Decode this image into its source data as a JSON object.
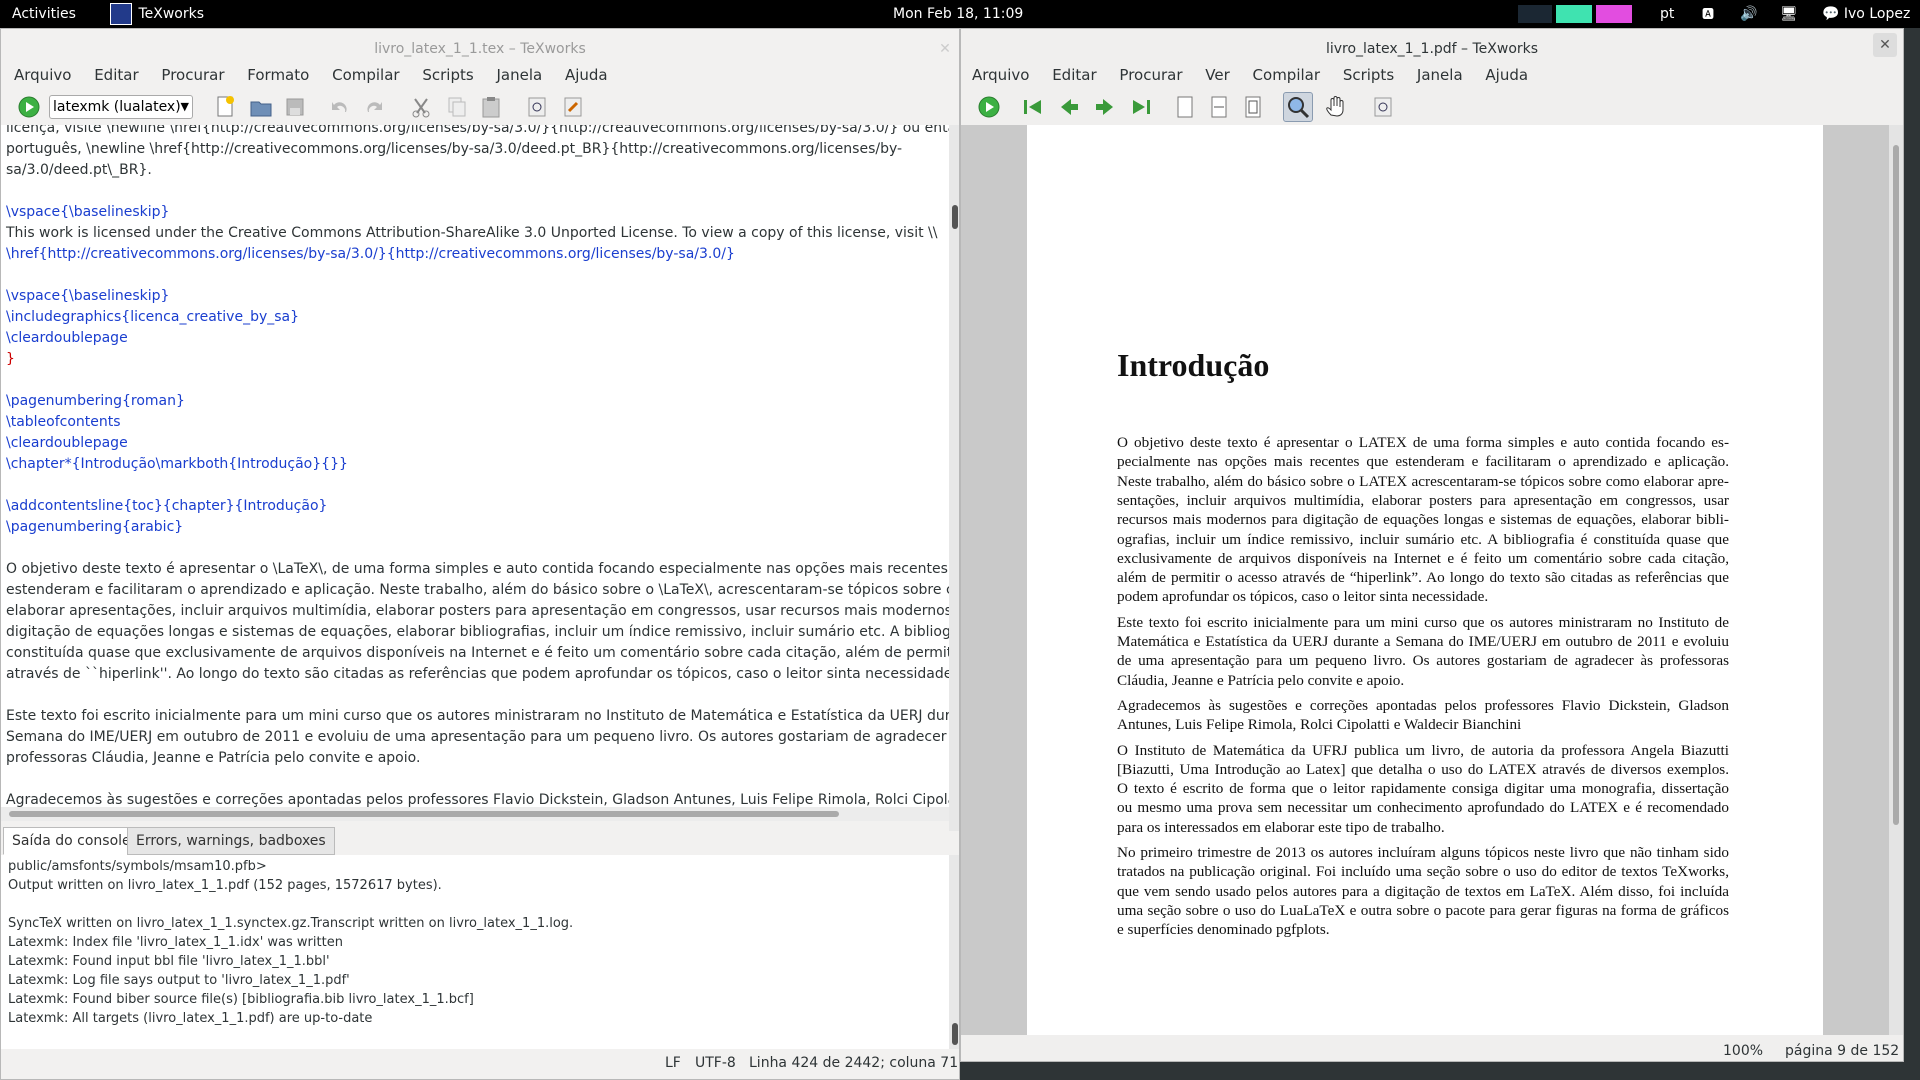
{
  "topbar": {
    "activities": "Activities",
    "app_name": "TeXworks",
    "clock": "Mon Feb 18, 11:09",
    "keyboard": "pt",
    "user": "Ivo Lopez"
  },
  "editor_window": {
    "title": "livro_latex_1_1.tex – TeXworks",
    "menu": [
      "Arquivo",
      "Editar",
      "Procurar",
      "Formato",
      "Compilar",
      "Scripts",
      "Janela",
      "Ajuda"
    ],
    "engine_select": "latexmk (lualatex)",
    "lines": [
      "licença, visite \\newline \\href{http://creativecommons.org/licenses/by-sa/3.0/}{http://creativecommons.org/licenses/by-sa/3.0/} ou então, em",
      "português, \\newline \\href{http://creativecommons.org/licenses/by-sa/3.0/deed.pt_BR}{http://creativecommons.org/licenses/by-",
      "sa/3.0/deed.pt\\_BR}.",
      "",
      "   \\vspace{\\baselineskip}",
      "   This work is licensed under the Creative Commons Attribution-ShareAlike 3.0 Unported License. To view a copy of this license, visit \\\\",
      "   \\href{http://creativecommons.org/licenses/by-sa/3.0/}{http://creativecommons.org/licenses/by-sa/3.0/}",
      "",
      "   \\vspace{\\baselineskip}",
      "   \\includegraphics{licenca_creative_by_sa}",
      "   \\cleardoublepage",
      "}",
      "",
      "\\pagenumbering{roman}",
      "\\tableofcontents",
      "\\cleardoublepage",
      "\\chapter*{Introdução\\markboth{Introdução}{}}",
      "",
      "\\addcontentsline{toc}{chapter}{Introdução}",
      "\\pagenumbering{arabic}",
      "",
      "O objetivo deste texto é apresentar o \\LaTeX\\, de uma forma simples e auto contida focando especialmente nas opções mais recentes que",
      "estenderam e facilitaram o aprendizado e aplicação. Neste trabalho, além do básico sobre o \\LaTeX\\, acrescentaram-se tópicos sobre como",
      "elaborar apresentações, incluir arquivos multimídia, elaborar posters para apresentação em congressos, usar recursos mais modernos para",
      "digitação de equações longas e sistemas de equações, elaborar bibliografias, incluir um índice remissivo, incluir sumário etc. A bibliografia é",
      "constituída quase que exclusivamente de arquivos disponíveis na Internet  e é feito um comentário sobre cada citação, além de permitir o acesso",
      "através de ``hiperlink''.  Ao longo do texto são citadas as referências que podem aprofundar os tópicos, caso o leitor sinta necessidade.",
      "",
      "Este texto foi escrito inicialmente para um mini curso que os autores ministraram no Instituto de Matemática e Estatística da UERJ durante a",
      "Semana do IME/UERJ em outubro de 2011 e evoluiu de uma apresentação para um pequeno livro.  Os autores gostariam  de agradecer às",
      "professoras Cláudia, Jeanne e Patrícia pelo convite e apoio.",
      "",
      "Agradecemos às sugestões e correções apontadas pelos professores Flavio Dickstein, Gladson Antunes, Luis Felipe Rimola, Rolci Cipolatti e"
    ],
    "tabs": [
      "Saída do console",
      "Errors, warnings, badboxes"
    ],
    "console": [
      "public/amsfonts/symbols/msam10.pfb>",
      "Output written on livro_latex_1_1.pdf (152 pages, 1572617 bytes).",
      "",
      "SyncTeX written on livro_latex_1_1.synctex.gz.Transcript written on livro_latex_1_1.log.",
      "Latexmk: Index file 'livro_latex_1_1.idx' was written",
      "Latexmk: Found input bbl file 'livro_latex_1_1.bbl'",
      "Latexmk: Log file says output to 'livro_latex_1_1.pdf'",
      "Latexmk: Found biber source file(s) [bibliografia.bib livro_latex_1_1.bcf]",
      "Latexmk: All targets (livro_latex_1_1.pdf) are up-to-date"
    ],
    "status": {
      "eol": "LF",
      "encoding": "UTF-8",
      "position": "Linha 424 de 2442; coluna 71"
    }
  },
  "pdf_window": {
    "title": "livro_latex_1_1.pdf – TeXworks",
    "menu": [
      "Arquivo",
      "Editar",
      "Procurar",
      "Ver",
      "Compilar",
      "Scripts",
      "Janela",
      "Ajuda"
    ],
    "page_title": "Introdução",
    "lines": [
      "O objetivo deste texto é apresentar o LATEX de uma forma simples e auto contida focando es-",
      "pecialmente nas opções mais recentes que estenderam e facilitaram o aprendizado e aplicação.",
      "Neste trabalho, além do básico sobre o LATEX acrescentaram-se tópicos sobre como elaborar apre-",
      "sentações, incluir arquivos multimídia, elaborar posters para apresentação em congressos, usar",
      "recursos mais modernos para digitação de equações longas e sistemas de equações, elaborar bibli-",
      "ografias, incluir um índice remissivo, incluir sumário etc.  A bibliografia é constituída quase que",
      "exclusivamente de arquivos disponíveis na Internet e é feito um comentário sobre cada citação,",
      "além de permitir o acesso através de “hiperlink”.  Ao longo do texto são citadas as referências que",
      "podem aprofundar os tópicos, caso o leitor sinta necessidade.",
      "Este texto foi escrito inicialmente para um mini curso que os autores ministraram no Instituto de",
      "Matemática e Estatística da UERJ durante a Semana do IME/UERJ em outubro de 2011 e evoluiu",
      "de uma apresentação para um pequeno livro.  Os autores gostariam de agradecer às professoras",
      "Cláudia, Jeanne e Patrícia pelo convite e apoio.",
      "Agradecemos às sugestões e correções apontadas pelos professores Flavio Dickstein, Gladson",
      "Antunes, Luis Felipe Rimola, Rolci Cipolatti e Waldecir Bianchini",
      "O Instituto de Matemática da UFRJ publica um livro, de autoria da professora Angela Biazutti",
      "[Biazutti, Uma Introdução ao Latex] que detalha o uso do LATEX através de diversos exemplos.",
      "O texto é escrito de forma que o leitor rapidamente consiga digitar uma monografia, dissertação",
      "ou mesmo uma prova sem necessitar um conhecimento aprofundado do LATEX e é recomendado",
      "para os interessados em elaborar este tipo de trabalho.",
      "No primeiro trimestre de 2013 os autores incluíram alguns tópicos neste livro que não tinham sido",
      "tratados na publicação original.  Foi incluído uma seção sobre o uso do editor de textos TeXworks,",
      "que vem sendo usado pelos autores para a digitação de textos em LaTeX. Além disso, foi incluída",
      "uma seção sobre o uso do LuaLaTeX e outra sobre o pacote para gerar figuras na forma de gráficos",
      "e superfícies denominado pgfplots."
    ],
    "status": {
      "zoom": "100%",
      "page": "página 9 de 152"
    }
  }
}
